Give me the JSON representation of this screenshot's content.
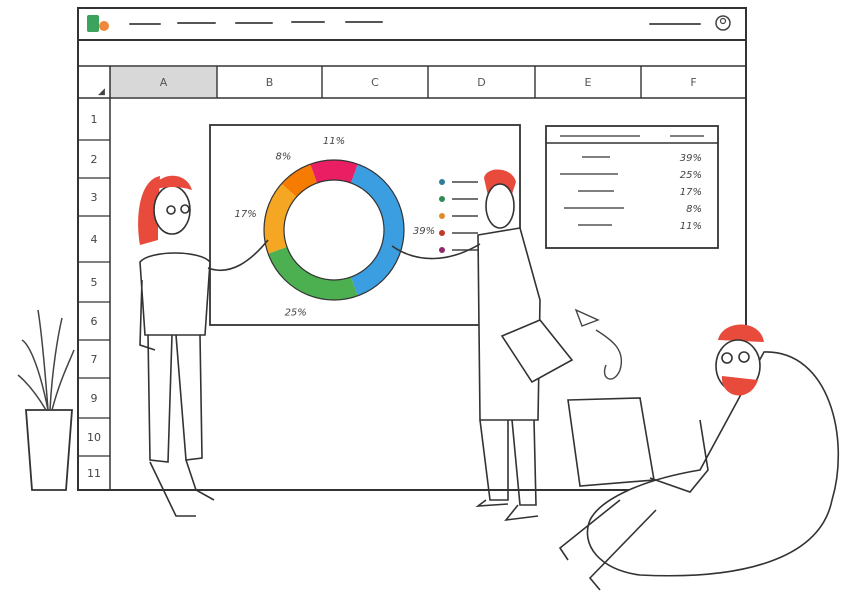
{
  "spreadsheet": {
    "columns": [
      "A",
      "B",
      "C",
      "D",
      "E",
      "F"
    ],
    "rows": [
      "1",
      "2",
      "3",
      "4",
      "5",
      "6",
      "7",
      "9",
      "10",
      "11"
    ]
  },
  "chart_data": {
    "type": "pie",
    "slices": [
      {
        "value": 39,
        "label": "39%",
        "color": "#3a9ee0"
      },
      {
        "value": 25,
        "label": "25%",
        "color": "#4caf50"
      },
      {
        "value": 17,
        "label": "17%",
        "color": "#f5a623"
      },
      {
        "value": 8,
        "label": "8%",
        "color": "#f57c00"
      },
      {
        "value": 11,
        "label": "11%",
        "color": "#e91e63"
      }
    ],
    "legend_colors": [
      "#2e7d9a",
      "#2e8b57",
      "#e08a2c",
      "#c0392b",
      "#8e2a6b"
    ]
  },
  "side_table": {
    "values": [
      "39%",
      "25%",
      "17%",
      "8%",
      "11%"
    ]
  },
  "colors": {
    "hair": "#e84a3c",
    "line": "#333333",
    "logo_green": "#3ba35b",
    "logo_orange": "#f0883a"
  }
}
